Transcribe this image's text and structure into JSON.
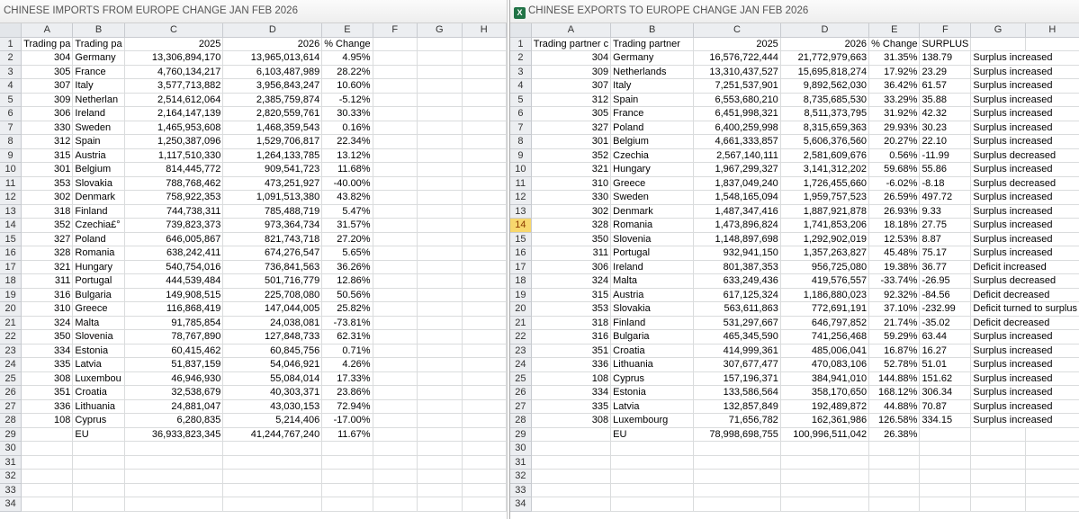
{
  "left": {
    "title": "CHINESE IMPORTS FROM EUROPE CHANGE JAN FEB 2026",
    "col_headers": [
      "A",
      "B",
      "C",
      "D",
      "E",
      "F",
      "G",
      "H"
    ],
    "header_row": [
      "Trading pa",
      "Trading pa",
      "2025",
      "2026",
      "% Change",
      "",
      "",
      ""
    ],
    "rows": [
      [
        "304",
        "Germany",
        "13,306,894,170",
        "13,965,013,614",
        "4.95%"
      ],
      [
        "305",
        "France",
        "4,760,134,217",
        "6,103,487,989",
        "28.22%"
      ],
      [
        "307",
        "Italy",
        "3,577,713,882",
        "3,956,843,247",
        "10.60%"
      ],
      [
        "309",
        "Netherlan",
        "2,514,612,064",
        "2,385,759,874",
        "-5.12%"
      ],
      [
        "306",
        "Ireland",
        "2,164,147,139",
        "2,820,559,761",
        "30.33%"
      ],
      [
        "330",
        "Sweden",
        "1,465,953,608",
        "1,468,359,543",
        "0.16%"
      ],
      [
        "312",
        "Spain",
        "1,250,387,096",
        "1,529,706,817",
        "22.34%"
      ],
      [
        "315",
        "Austria",
        "1,117,510,330",
        "1,264,133,785",
        "13.12%"
      ],
      [
        "301",
        "Belgium",
        "814,445,772",
        "909,541,723",
        "11.68%"
      ],
      [
        "353",
        "Slovakia",
        "788,768,462",
        "473,251,927",
        "-40.00%"
      ],
      [
        "302",
        "Denmark",
        "758,922,353",
        "1,091,513,380",
        "43.82%"
      ],
      [
        "318",
        "Finland",
        "744,738,311",
        "785,488,719",
        "5.47%"
      ],
      [
        "352",
        "Czechia£°",
        "739,823,373",
        "973,364,734",
        "31.57%"
      ],
      [
        "327",
        "Poland",
        "646,005,867",
        "821,743,718",
        "27.20%"
      ],
      [
        "328",
        "Romania",
        "638,242,411",
        "674,276,547",
        "5.65%"
      ],
      [
        "321",
        "Hungary",
        "540,754,016",
        "736,841,563",
        "36.26%"
      ],
      [
        "311",
        "Portugal",
        "444,539,484",
        "501,716,779",
        "12.86%"
      ],
      [
        "316",
        "Bulgaria",
        "149,908,515",
        "225,708,080",
        "50.56%"
      ],
      [
        "310",
        "Greece",
        "116,868,419",
        "147,044,005",
        "25.82%"
      ],
      [
        "324",
        "Malta",
        "91,785,854",
        "24,038,081",
        "-73.81%"
      ],
      [
        "350",
        "Slovenia",
        "78,767,890",
        "127,848,733",
        "62.31%"
      ],
      [
        "334",
        "Estonia",
        "60,415,462",
        "60,845,756",
        "0.71%"
      ],
      [
        "335",
        "Latvia",
        "51,837,159",
        "54,046,921",
        "4.26%"
      ],
      [
        "308",
        "Luxembou",
        "46,946,930",
        "55,084,014",
        "17.33%"
      ],
      [
        "351",
        "Croatia",
        "32,538,679",
        "40,303,371",
        "23.86%"
      ],
      [
        "336",
        "Lithuania",
        "24,881,047",
        "43,030,153",
        "72.94%"
      ],
      [
        "108",
        "Cyprus",
        "6,280,835",
        "5,214,406",
        "-17.00%"
      ],
      [
        "",
        "EU",
        "36,933,823,345",
        "41,244,767,240",
        "11.67%"
      ]
    ],
    "row_numbers": [
      "1",
      "2",
      "3",
      "4",
      "5",
      "6",
      "7",
      "8",
      "9",
      "10",
      "11",
      "12",
      "13",
      "14",
      "15",
      "16",
      "17",
      "18",
      "19",
      "20",
      "21",
      "22",
      "23",
      "24",
      "25",
      "26",
      "27",
      "28",
      "29",
      "30",
      "31",
      "32",
      "33",
      "34"
    ]
  },
  "right": {
    "title": "CHINESE EXPORTS TO EUROPE CHANGE JAN FEB 2026",
    "app_icon": "excel-icon",
    "col_headers": [
      "A",
      "B",
      "C",
      "D",
      "E",
      "F",
      "G",
      "H"
    ],
    "header_row": [
      "Trading partner c",
      "Trading partner",
      "2025",
      "2026",
      "% Change",
      "SURPLUS",
      "",
      ""
    ],
    "rows": [
      [
        "304",
        "Germany",
        "16,576,722,444",
        "21,772,979,663",
        "31.35%",
        "138.79",
        "Surplus increased"
      ],
      [
        "309",
        "Netherlands",
        "13,310,437,527",
        "15,695,818,274",
        "17.92%",
        "23.29",
        "Surplus increased"
      ],
      [
        "307",
        "Italy",
        "7,251,537,901",
        "9,892,562,030",
        "36.42%",
        "61.57",
        "Surplus increased"
      ],
      [
        "312",
        "Spain",
        "6,553,680,210",
        "8,735,685,530",
        "33.29%",
        "35.88",
        "Surplus increased"
      ],
      [
        "305",
        "France",
        "6,451,998,321",
        "8,511,373,795",
        "31.92%",
        "42.32",
        "Surplus increased"
      ],
      [
        "327",
        "Poland",
        "6,400,259,998",
        "8,315,659,363",
        "29.93%",
        "30.23",
        "Surplus increased"
      ],
      [
        "301",
        "Belgium",
        "4,661,333,857",
        "5,606,376,560",
        "20.27%",
        "22.10",
        "Surplus increased"
      ],
      [
        "352",
        "Czechia",
        "2,567,140,111",
        "2,581,609,676",
        "0.56%",
        "-11.99",
        "Surplus decreased"
      ],
      [
        "321",
        "Hungary",
        "1,967,299,327",
        "3,141,312,202",
        "59.68%",
        "55.86",
        "Surplus increased"
      ],
      [
        "310",
        "Greece",
        "1,837,049,240",
        "1,726,455,660",
        "-6.02%",
        "-8.18",
        "Surplus decreased"
      ],
      [
        "330",
        "Sweden",
        "1,548,165,094",
        "1,959,757,523",
        "26.59%",
        "497.72",
        "Surplus increased"
      ],
      [
        "302",
        "Denmark",
        "1,487,347,416",
        "1,887,921,878",
        "26.93%",
        "9.33",
        "Surplus increased"
      ],
      [
        "328",
        "Romania",
        "1,473,896,824",
        "1,741,853,206",
        "18.18%",
        "27.75",
        "Surplus increased"
      ],
      [
        "350",
        "Slovenia",
        "1,148,897,698",
        "1,292,902,019",
        "12.53%",
        "8.87",
        "Surplus increased"
      ],
      [
        "311",
        "Portugal",
        "932,941,150",
        "1,357,263,827",
        "45.48%",
        "75.17",
        "Surplus increased"
      ],
      [
        "306",
        "Ireland",
        "801,387,353",
        "956,725,080",
        "19.38%",
        "36.77",
        "Deficit increased"
      ],
      [
        "324",
        "Malta",
        "633,249,436",
        "419,576,557",
        "-33.74%",
        "-26.95",
        "Surplus decreased"
      ],
      [
        "315",
        "Austria",
        "617,125,324",
        "1,186,880,023",
        "92.32%",
        "-84.56",
        "Deficit decreased"
      ],
      [
        "353",
        "Slovakia",
        "563,611,863",
        "772,691,191",
        "37.10%",
        "-232.99",
        "Deficit turned to surplus"
      ],
      [
        "318",
        "Finland",
        "531,297,667",
        "646,797,852",
        "21.74%",
        "-35.02",
        "Deficit decreased"
      ],
      [
        "316",
        "Bulgaria",
        "465,345,590",
        "741,256,468",
        "59.29%",
        "63.44",
        "Surplus increased"
      ],
      [
        "351",
        "Croatia",
        "414,999,361",
        "485,006,041",
        "16.87%",
        "16.27",
        "Surplus increased"
      ],
      [
        "336",
        "Lithuania",
        "307,677,477",
        "470,083,106",
        "52.78%",
        "51.01",
        "Surplus increased"
      ],
      [
        "108",
        "Cyprus",
        "157,196,371",
        "384,941,010",
        "144.88%",
        "151.62",
        "Surplus increased"
      ],
      [
        "334",
        "Estonia",
        "133,586,564",
        "358,170,650",
        "168.12%",
        "306.34",
        "Surplus increased"
      ],
      [
        "335",
        "Latvia",
        "132,857,849",
        "192,489,872",
        "44.88%",
        "70.87",
        "Surplus increased"
      ],
      [
        "308",
        "Luxembourg",
        "71,656,782",
        "162,361,986",
        "126.58%",
        "334.15",
        "Surplus increased"
      ],
      [
        "",
        "EU",
        "78,998,698,755",
        "100,996,511,042",
        "26.38%",
        "",
        ""
      ]
    ],
    "row_numbers": [
      "1",
      "2",
      "3",
      "4",
      "5",
      "6",
      "7",
      "8",
      "9",
      "10",
      "11",
      "12",
      "13",
      "14",
      "15",
      "16",
      "17",
      "18",
      "19",
      "20",
      "21",
      "22",
      "23",
      "24",
      "25",
      "26",
      "27",
      "28",
      "29",
      "30",
      "31",
      "32",
      "33",
      "34"
    ],
    "selected_row": "14"
  }
}
